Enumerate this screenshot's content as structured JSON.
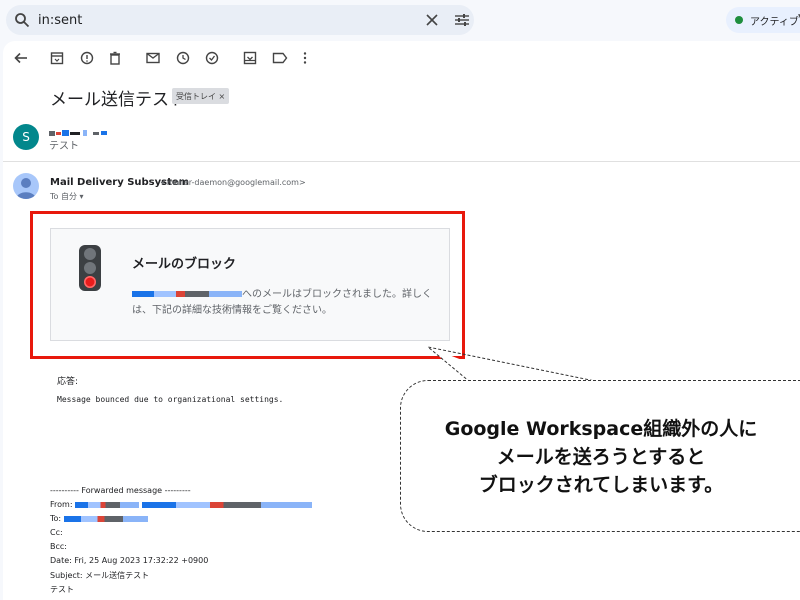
{
  "search": {
    "query": "in:sent"
  },
  "status": {
    "label": "アクティブ"
  },
  "email": {
    "subject": "メール送信テスト",
    "label_chip": "受信トレイ ×",
    "thread_first": {
      "avatar_letter": "S",
      "snippet": "テスト"
    },
    "message": {
      "sender_name": "Mail Delivery Subsystem",
      "sender_email": "<mailer-daemon@googlemail.com>",
      "to_line": "To 自分 ▾",
      "notice_title": "メールのブロック",
      "notice_body": "へのメールはブロックされました。詳しくは、下記の詳細な技術情報をご覧ください。",
      "reply_label": "応答:",
      "bounce_text": "Message bounced due to organizational settings.",
      "forwarded": {
        "header": "---------- Forwarded message ---------",
        "from_label": "From:",
        "to_label": "To:",
        "cc_label": "Cc:",
        "bcc_label": "Bcc:",
        "date_line": "Date: Fri, 25 Aug 2023 17:32:22 +0900",
        "subject_line": "Subject: メール送信テスト",
        "body": "テスト"
      }
    }
  },
  "callout": {
    "line1": "Google Workspace組織外の人に",
    "line2": "メールを送ろうとすると",
    "line3": "ブロックされてしまいます。"
  },
  "colors": {
    "highlight": "#e8180c",
    "avatar": "#02878c",
    "status_dot": "#1e8e3e"
  }
}
